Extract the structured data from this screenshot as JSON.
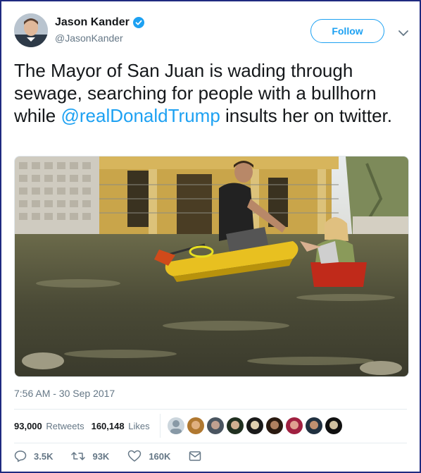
{
  "author": {
    "name": "Jason Kander",
    "handle": "@JasonKander",
    "verified": true
  },
  "follow_label": "Follow",
  "tweet": {
    "text_before": "The Mayor of San Juan is wading through sewage, searching for people with a bullhorn while ",
    "mention": "@realDonaldTrump",
    "text_after": " insults her on twitter."
  },
  "timestamp": "7:56 AM - 30 Sep 2017",
  "stats": {
    "retweets_count": "93,000",
    "retweets_label": "Retweets",
    "likes_count": "160,148",
    "likes_label": "Likes"
  },
  "actions": {
    "replies": "3.5K",
    "retweets": "93K",
    "likes": "160K"
  },
  "colors": {
    "accent": "#1da1f2",
    "muted": "#657786",
    "frame": "#1f2a80"
  }
}
